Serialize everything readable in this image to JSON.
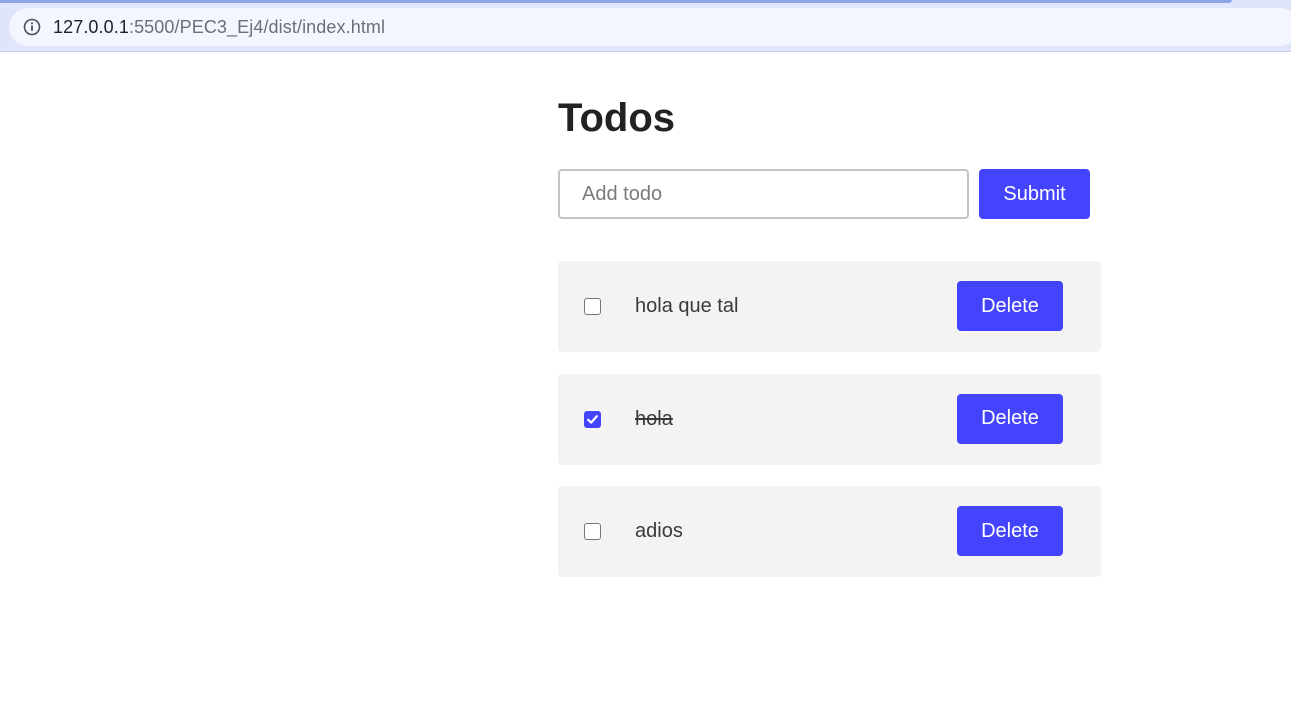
{
  "browser": {
    "url_host": "127.0.0.1",
    "url_rest": ":5500/PEC3_Ej4/dist/index.html"
  },
  "app": {
    "title": "Todos",
    "input_placeholder": "Add todo",
    "input_value": "",
    "submit_label": "Submit"
  },
  "todos": [
    {
      "text": "hola que tal",
      "completed": false,
      "delete_label": "Delete"
    },
    {
      "text": "hola",
      "completed": true,
      "delete_label": "Delete"
    },
    {
      "text": "adios",
      "completed": false,
      "delete_label": "Delete"
    }
  ],
  "colors": {
    "accent": "#4444ff",
    "item_background": "#f3f3f3"
  }
}
